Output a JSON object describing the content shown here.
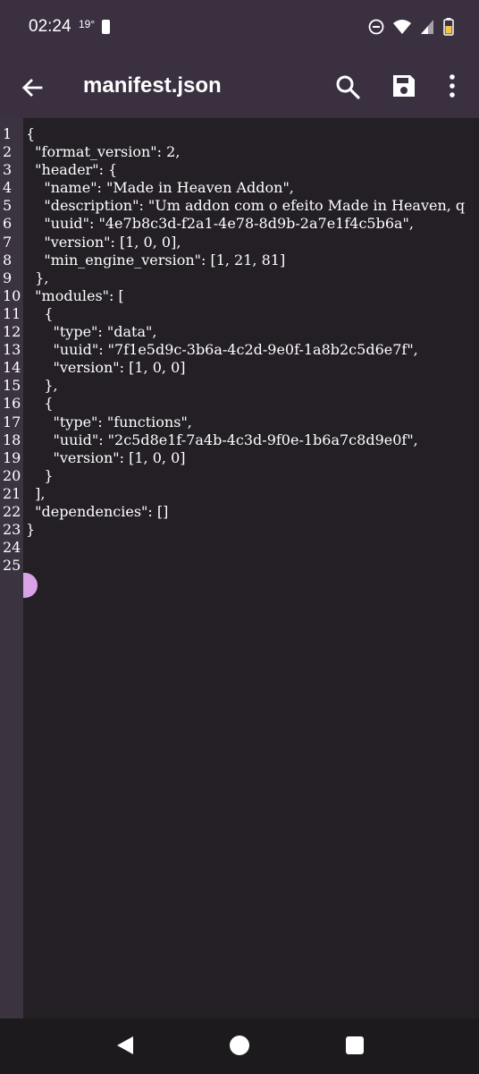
{
  "status_bar": {
    "time": "02:24",
    "temperature": "19°"
  },
  "app_bar": {
    "title": "manifest.json",
    "icons": [
      "arrow-back-icon",
      "search-icon",
      "save-icon",
      "more-vert-icon"
    ]
  },
  "editor": {
    "line_numbers": [
      "1",
      "2",
      "3",
      "4",
      "5",
      "6",
      "7",
      "8",
      "9",
      "10",
      "11",
      "12",
      "13",
      "14",
      "15",
      "16",
      "17",
      "18",
      "19",
      "20",
      "21",
      "22",
      "23",
      "24",
      "25"
    ],
    "lines": [
      "{",
      "  \"format_version\": 2,",
      "  \"header\": {",
      "    \"name\": \"Made in Heaven Addon\",",
      "    \"description\": \"Um addon com o efeito Made in Heaven, q",
      "    \"uuid\": \"4e7b8c3d-f2a1-4e78-8d9b-2a7e1f4c5b6a\",",
      "    \"version\": [1, 0, 0],",
      "    \"min_engine_version\": [1, 21, 81]",
      "  },",
      "  \"modules\": [",
      "    {",
      "      \"type\": \"data\",",
      "      \"uuid\": \"7f1e5d9c-3b6a-4c2d-9e0f-1a8b2c5d6e7f\",",
      "      \"version\": [1, 0, 0]",
      "    },",
      "    {",
      "      \"type\": \"functions\",",
      "      \"uuid\": \"2c5d8e1f-7a4b-4c3d-9f0e-1b6a7c8d9e0f\",",
      "      \"version\": [1, 0, 0]",
      "    }",
      "  ],",
      "  \"dependencies\": []",
      "}",
      "",
      ""
    ]
  },
  "colors": {
    "app_bar": "#3a3040",
    "editor_bg": "#231f25",
    "gutter": "#3b3340",
    "cursor_handle": "#d9a2e6",
    "nav_bar": "#1c1a1d"
  }
}
